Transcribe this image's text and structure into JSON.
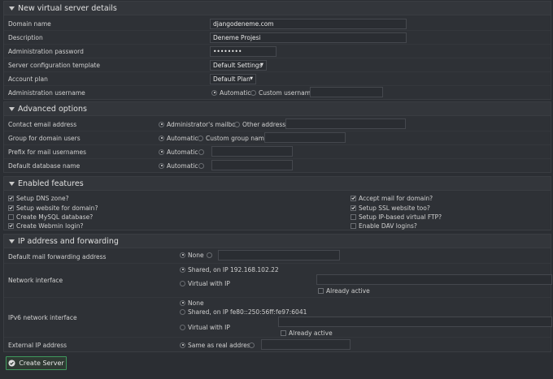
{
  "sections": {
    "details": {
      "title": "New virtual server details",
      "domain_label": "Domain name",
      "domain_value": "djangodeneme.com",
      "desc_label": "Description",
      "desc_value": "Deneme Projesi",
      "pass_label": "Administration password",
      "pass_value": "••••••••",
      "template_label": "Server configuration template",
      "template_value": "Default Settings",
      "plan_label": "Account plan",
      "plan_value": "Default Plan",
      "user_label": "Administration username",
      "user_auto": "Automatic",
      "user_custom": "Custom username"
    },
    "advanced": {
      "title": "Advanced options",
      "email_label": "Contact email address",
      "email_opt1": "Administrator's mailbox",
      "email_opt2": "Other address..",
      "group_label": "Group for domain users",
      "group_auto": "Automatic",
      "group_custom": "Custom group name",
      "prefix_label": "Prefix for mail usernames",
      "prefix_auto": "Automatic",
      "db_label": "Default database name",
      "db_auto": "Automatic"
    },
    "features": {
      "title": "Enabled features",
      "left": [
        {
          "label": "Setup DNS zone?",
          "checked": true
        },
        {
          "label": "Setup website for domain?",
          "checked": true
        },
        {
          "label": "Create MySQL database?",
          "checked": false
        },
        {
          "label": "Create Webmin login?",
          "checked": true
        }
      ],
      "right": [
        {
          "label": "Accept mail for domain?",
          "checked": true
        },
        {
          "label": "Setup SSL website too?",
          "checked": true
        },
        {
          "label": "Setup IP-based virtual FTP?",
          "checked": false
        },
        {
          "label": "Enable DAV logins?",
          "checked": false
        }
      ]
    },
    "ip": {
      "title": "IP address and forwarding",
      "fwd_label": "Default mail forwarding address",
      "fwd_none": "None",
      "net_label": "Network interface",
      "net_shared": "Shared, on IP 192.168.102.22",
      "net_virtual": "Virtual with IP",
      "net_active": "Already active",
      "ipv6_label": "IPv6 network interface",
      "ipv6_none": "None",
      "ipv6_shared": "Shared, on IP fe80::250:56ff:fe97:6041",
      "ipv6_virtual": "Virtual with IP",
      "ipv6_active": "Already active",
      "ext_label": "External IP address",
      "ext_same": "Same as real address"
    }
  },
  "create_button": "Create Server"
}
